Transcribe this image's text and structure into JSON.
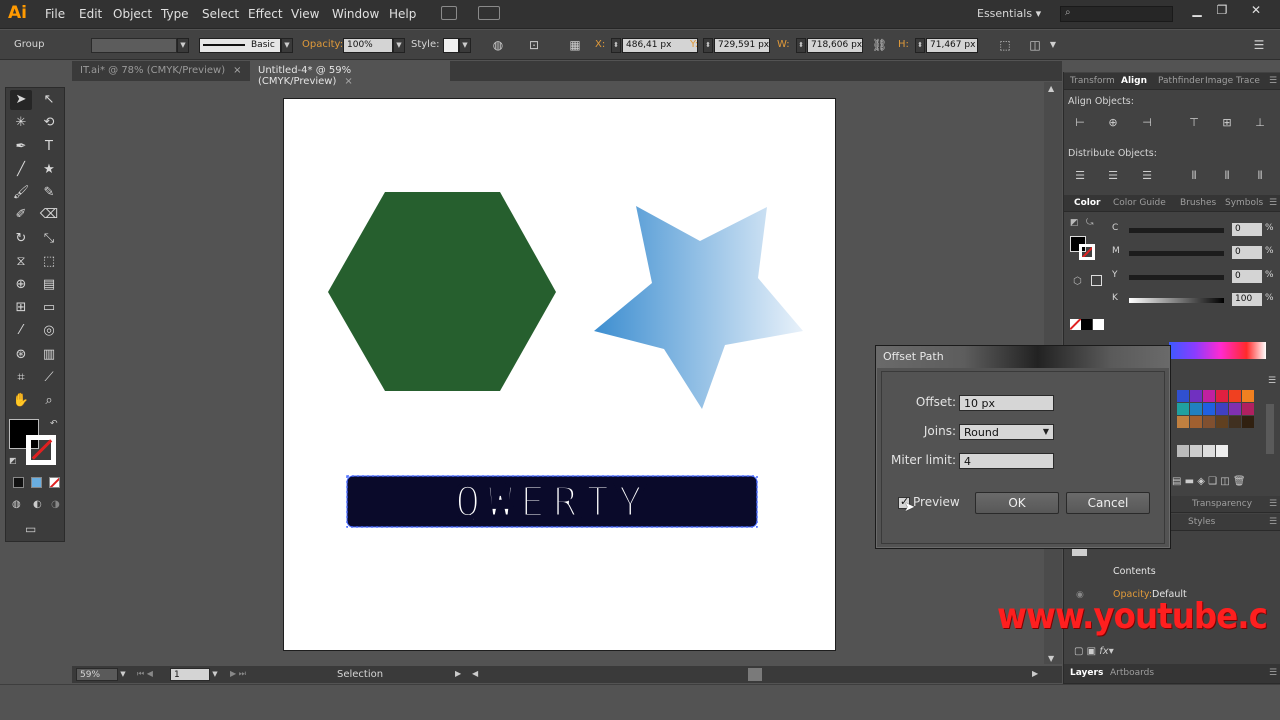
{
  "app": {
    "logo": "Ai"
  },
  "menubar": {
    "items": [
      "File",
      "Edit",
      "Object",
      "Type",
      "Select",
      "Effect",
      "View",
      "Window",
      "Help"
    ],
    "workspace": "Essentials"
  },
  "controlbar": {
    "selection_type": "Group",
    "stroke_style": "Basic",
    "opacity_label": "Opacity:",
    "opacity_value": "100%",
    "style_label": "Style:",
    "x_label": "X:",
    "x_value": "486,41 px",
    "y_label": "Y:",
    "y_value": "729,591 px",
    "w_label": "W:",
    "w_value": "718,606 px",
    "h_label": "H:",
    "h_value": "71,467 px"
  },
  "tabs": [
    {
      "label": "IT.ai* @ 78% (CMYK/Preview)",
      "close": "×"
    },
    {
      "label": "Untitled-4* @ 59% (CMYK/Preview)",
      "close": "×"
    }
  ],
  "canvas": {
    "text_art": "QWERTY",
    "colors": {
      "hexagon": "#265f2e",
      "star_start": "#3d8ed0",
      "star_end": "#e8f1fa",
      "text_fill": "#0a0a2a",
      "selection": "#4a6cff"
    }
  },
  "status": {
    "zoom": "59%",
    "artboard": "1",
    "tool": "Selection"
  },
  "panels": {
    "top_tabs": [
      "Transform",
      "Align",
      "Pathfinder",
      "Image Trace"
    ],
    "align_objects": "Align Objects:",
    "distribute_objects": "Distribute Objects:",
    "color_tabs": [
      "Color",
      "Color Guide",
      "Brushes",
      "Symbols"
    ],
    "cmyk": [
      {
        "letter": "C",
        "value": "0",
        "pct": "%"
      },
      {
        "letter": "M",
        "value": "0",
        "pct": "%"
      },
      {
        "letter": "Y",
        "value": "0",
        "pct": "%"
      },
      {
        "letter": "K",
        "value": "100",
        "pct": "%"
      }
    ],
    "transparency_tab": "Transparency",
    "styles_tab": "Styles",
    "appearance_contents": "Contents",
    "appearance_opacity_label": "Opacity:",
    "appearance_opacity_value": "Default",
    "bottom_tabs": [
      "Layers",
      "Artboards"
    ]
  },
  "dialog": {
    "title": "Offset Path",
    "offset_label": "Offset:",
    "offset_value": "10 px",
    "joins_label": "Joins:",
    "joins_value": "Round",
    "miter_label": "Miter limit:",
    "miter_value": "4",
    "preview_label": "Preview",
    "ok_label": "OK",
    "cancel_label": "Cancel"
  },
  "watermark": "www.youtube.c"
}
